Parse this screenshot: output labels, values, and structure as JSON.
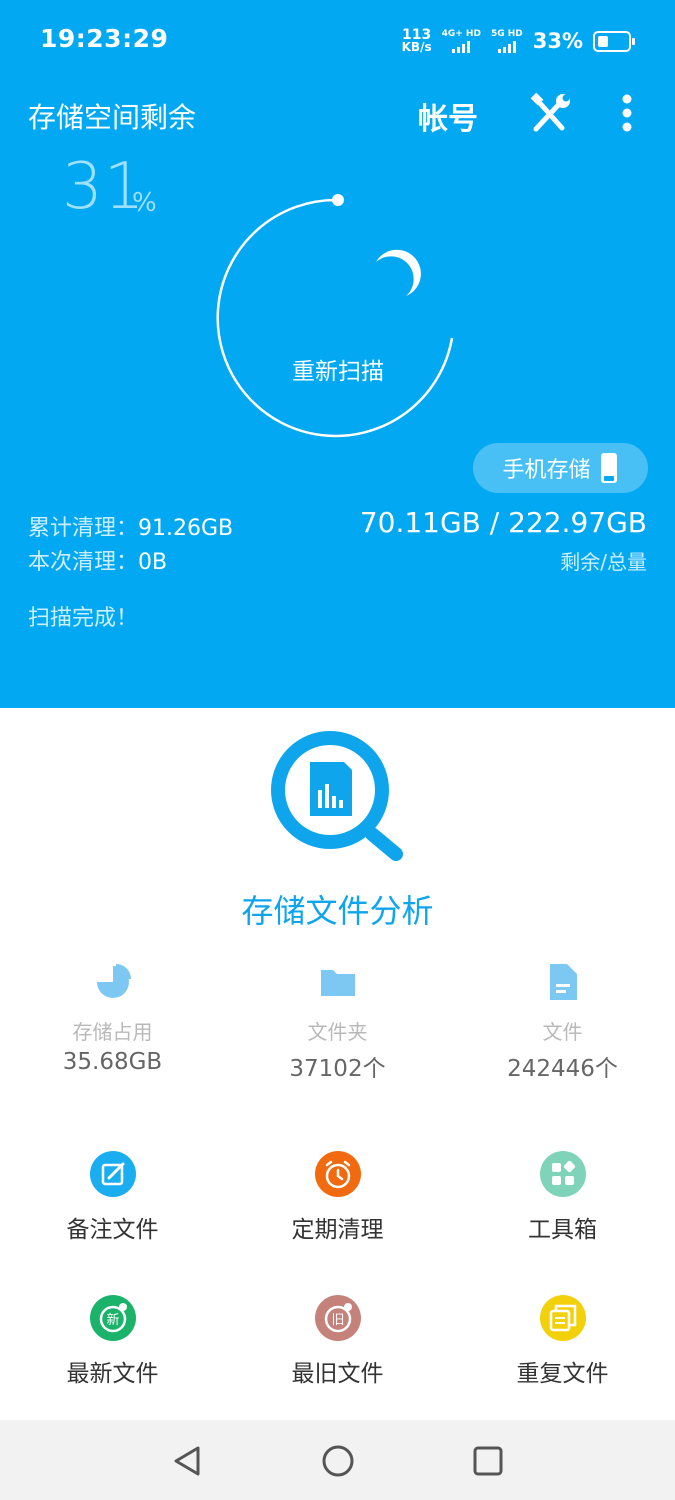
{
  "status_bar": {
    "time": "19:23:29",
    "net_speed_value": "113",
    "net_speed_unit": "KB/s",
    "sim1_label": "4G+ HD",
    "sim2_label": "5G HD",
    "battery": "33%"
  },
  "header": {
    "title": "存储空间剩余",
    "account_label": "帐号",
    "remaining_percent": "31",
    "percent_unit": "%",
    "rescan_label": "重新扫描",
    "storage_chip_label": "手机存储",
    "total_cleaned_label": "累计清理：",
    "total_cleaned_value": "91.26GB",
    "this_clean_label": "本次清理：",
    "this_clean_value": "0B",
    "capacity": "70.11GB / 222.97GB",
    "capacity_label": "剩余/总量",
    "scan_status": "扫描完成！",
    "bg_color": "#02a8f2"
  },
  "analysis": {
    "title": "存储文件分析",
    "metrics": [
      {
        "label": "存储占用",
        "value": "35.68GB",
        "icon": "pie-chart-icon"
      },
      {
        "label": "文件夹",
        "value": "37102个",
        "icon": "folder-icon"
      },
      {
        "label": "文件",
        "value": "242446个",
        "icon": "file-icon"
      }
    ]
  },
  "features": [
    {
      "label": "备注文件",
      "icon": "edit-note-icon",
      "color": "#1aaef0"
    },
    {
      "label": "定期清理",
      "icon": "alarm-clock-icon",
      "color": "#f26a0f"
    },
    {
      "label": "工具箱",
      "icon": "toolbox-grid-icon",
      "color": "#7fd3b8"
    },
    {
      "label": "最新文件",
      "icon": "new-badge-icon",
      "color": "#1bb36a"
    },
    {
      "label": "最旧文件",
      "icon": "old-badge-icon",
      "color": "#c4827a"
    },
    {
      "label": "重复文件",
      "icon": "duplicate-files-icon",
      "color": "#f2d10a"
    }
  ],
  "badges": {
    "new_char": "新",
    "old_char": "旧"
  }
}
